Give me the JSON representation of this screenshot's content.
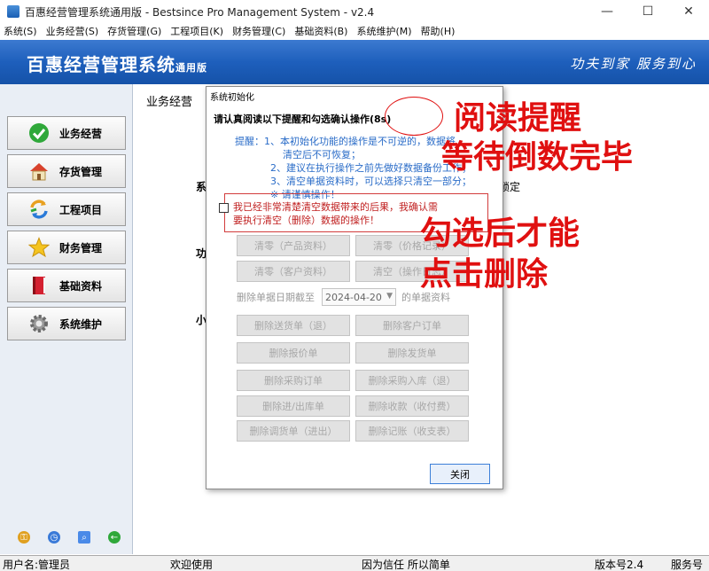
{
  "window": {
    "title": "百惠经营管理系统通用版 - Bestsince Pro Management System - v2.4",
    "controls": [
      "—",
      "☐",
      "✕"
    ]
  },
  "menu": [
    "系统(S)",
    "业务经营(S)",
    "存货管理(G)",
    "工程项目(K)",
    "财务管理(C)",
    "基础资料(B)",
    "系统维护(M)",
    "帮助(H)"
  ],
  "banner": {
    "brand": "百惠经营管理系统",
    "brand_suffix": "通用版",
    "slogan": "功夫到家 服务到心"
  },
  "sidebar": {
    "items": [
      {
        "label": "业务经营",
        "icon": "checkmark-icon"
      },
      {
        "label": "存货管理",
        "icon": "house-icon"
      },
      {
        "label": "工程项目",
        "icon": "refresh-arrows-icon"
      },
      {
        "label": "财务管理",
        "icon": "star-icon"
      },
      {
        "label": "基础资料",
        "icon": "book-icon"
      },
      {
        "label": "系统维护",
        "icon": "gear-icon"
      }
    ],
    "bottom_icons": [
      "key-icon",
      "clock-icon",
      "search-icon",
      "back-arrow-icon"
    ]
  },
  "main": {
    "title": "业务经营",
    "fragments": [
      "系",
      "功",
      "小",
      "锁定"
    ]
  },
  "dialog": {
    "title": "系统初始化",
    "headline": "请认真阅读以下提醒和勾选确认操作(8s)",
    "notes": [
      "提醒：1、本初始化功能的操作是不可逆的，数据将",
      "清空后不可恢复；",
      "2、建议在执行操作之前先做好数据备份工作；",
      "3、清空单据资料时，可以选择只清空一部分；",
      "※ 请谨慎操作！"
    ],
    "confirm_line1": "我已经非常清楚清空数据带来的后果，我确认需",
    "confirm_line2": "要执行清空（删除）数据的操作！",
    "clear_buttons": [
      "清零（产品资料）",
      "清零（价格记录）",
      "清零（客户资料）",
      "清空（操作日志）"
    ],
    "date_prefix": "删除单据日期截至",
    "date_value": "2024-04-20",
    "date_suffix": "的单据资料",
    "delete_buttons": [
      "删除送货单（退）",
      "删除客户订单",
      "删除报价单",
      "删除发货单",
      "删除采购订单",
      "删除采购入库（退）",
      "删除进/出库单",
      "删除收款（收付费）",
      "删除调货单（进出）",
      "删除记账（收支表）"
    ],
    "close_label": "关闭"
  },
  "annotations": {
    "line1": "阅读提醒",
    "line2": "等待倒数完毕",
    "line3": "勾选后才能",
    "line4": "点击删除"
  },
  "status": {
    "user": "用户名:管理员",
    "welcome": "欢迎使用",
    "motto": "因为信任 所以简单",
    "version": "版本号2.4",
    "service": "服务号"
  },
  "colors": {
    "banner": "#1e5fbc",
    "annotation": "#e01010",
    "note_text": "#2a6cc8",
    "confirm_text": "#c02020"
  }
}
